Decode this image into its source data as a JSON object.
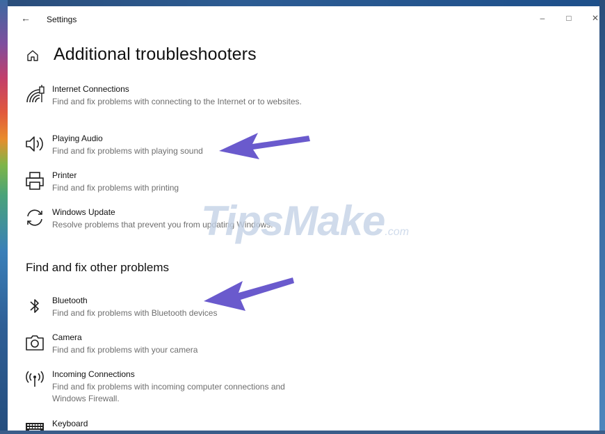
{
  "window": {
    "title": "Settings",
    "controls": {
      "minimize": "–",
      "maximize": "□",
      "close": "✕"
    },
    "back_icon": "back-arrow-icon"
  },
  "header": {
    "home_icon": "home-icon",
    "title": "Additional troubleshooters"
  },
  "troubleshooters": [
    {
      "icon": "internet-connections-icon",
      "label": "Internet Connections",
      "desc": "Find and fix problems with connecting to the Internet or to websites."
    },
    {
      "icon": "speaker-icon",
      "label": "Playing Audio",
      "desc": "Find and fix problems with playing sound"
    },
    {
      "icon": "printer-icon",
      "label": "Printer",
      "desc": "Find and fix problems with printing"
    },
    {
      "icon": "refresh-icon",
      "label": "Windows Update",
      "desc": "Resolve problems that prevent you from updating Windows."
    }
  ],
  "other_section": {
    "title": "Find and fix other problems"
  },
  "other_problems": [
    {
      "icon": "bluetooth-icon",
      "label": "Bluetooth",
      "desc": "Find and fix problems with Bluetooth devices"
    },
    {
      "icon": "camera-icon",
      "label": "Camera",
      "desc": "Find and fix problems with your camera"
    },
    {
      "icon": "incoming-connections-icon",
      "label": "Incoming Connections",
      "desc": "Find and fix problems with incoming computer connections and Windows Firewall."
    },
    {
      "icon": "keyboard-icon",
      "label": "Keyboard",
      "desc": ""
    }
  ],
  "watermark": {
    "main": "TipsMake",
    "suffix": ".com"
  },
  "colors": {
    "arrow": "#6a5acd",
    "accent": "#0078d4"
  }
}
